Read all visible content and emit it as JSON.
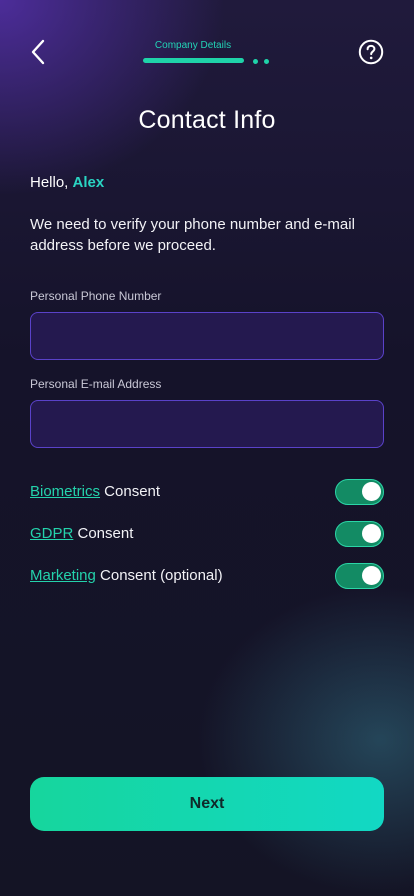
{
  "header": {
    "back_icon": "chevron-left-icon",
    "help_icon": "question-circle-icon",
    "progress": {
      "step_label": "Company Details",
      "current_step": 1,
      "total_steps": 3,
      "active_color": "#1fd3a9"
    }
  },
  "page": {
    "title": "Contact Info",
    "greeting_prefix": "Hello, ",
    "user_name": "Alex",
    "intro": "We need to verify your phone number and e-mail address before we proceed."
  },
  "form": {
    "phone": {
      "label": "Personal Phone Number",
      "value": "",
      "placeholder": ""
    },
    "email": {
      "label": "Personal E-mail Address",
      "value": "",
      "placeholder": ""
    }
  },
  "consents": [
    {
      "link": "Biometrics",
      "suffix": " Consent",
      "enabled": true
    },
    {
      "link": "GDPR",
      "suffix": " Consent",
      "enabled": true
    },
    {
      "link": "Marketing",
      "suffix": " Consent (optional)",
      "enabled": true
    }
  ],
  "footer": {
    "next_label": "Next"
  },
  "colors": {
    "accent": "#24d3ac",
    "name_highlight": "#2ad4c3",
    "input_border": "#5a42c9",
    "toggle_on": "#138b64",
    "button_gradient_start": "#16d69d",
    "button_gradient_end": "#12d8c4"
  }
}
